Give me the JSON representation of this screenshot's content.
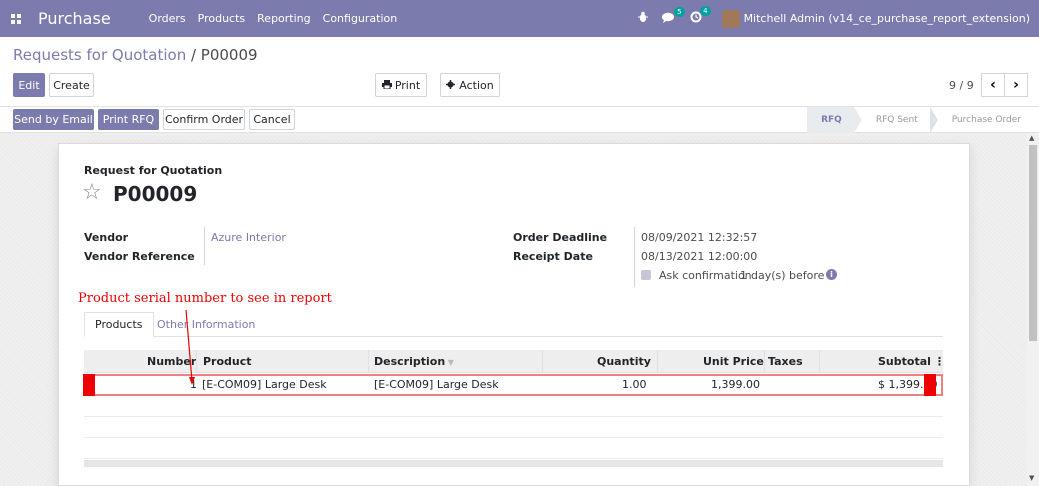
{
  "navbar": {
    "brand": "Purchase",
    "menu": [
      "Orders",
      "Products",
      "Reporting",
      "Configuration"
    ],
    "bug_icon": "bug-icon",
    "chat_badge": "5",
    "activity_badge": "4",
    "user": "Mitchell Admin (v14_ce_purchase_report_extension)"
  },
  "breadcrumb": {
    "parent": "Requests for Quotation",
    "separator": " / ",
    "current": "P00009"
  },
  "control": {
    "edit": "Edit",
    "create": "Create",
    "print": "Print",
    "action": "Action",
    "pager": "9 / 9",
    "prev": "‹",
    "next": "›"
  },
  "statusbar": {
    "buttons": [
      "Send by Email",
      "Print RFQ",
      "Confirm Order",
      "Cancel"
    ],
    "stages": [
      "RFQ",
      "RFQ Sent",
      "Purchase Order"
    ],
    "active_stage": "RFQ"
  },
  "form": {
    "doc_kind": "Request for Quotation",
    "name": "P00009",
    "vendor_label": "Vendor",
    "vendor": "Azure Interior",
    "vendor_ref_label": "Vendor Reference",
    "vendor_ref": "",
    "deadline_label": "Order Deadline",
    "deadline": "08/09/2021 12:32:57",
    "receipt_label": "Receipt Date",
    "receipt": "08/13/2021 12:00:00",
    "ask_confirmation_pre": "Ask confirmation",
    "ask_confirmation_days": "1",
    "ask_confirmation_post": "day(s) before",
    "ask_confirmation_checked": true
  },
  "annotation": "Product serial number to see in report",
  "tabs": [
    "Products",
    "Other Information"
  ],
  "table": {
    "headers": [
      "Number",
      "Product",
      "Description",
      "Quantity",
      "Unit Price",
      "Taxes",
      "Subtotal"
    ],
    "rows": [
      {
        "number": "1",
        "product": "[E-COM09] Large Desk",
        "description": "[E-COM09] Large Desk",
        "quantity": "1.00",
        "unit_price": "1,399.00",
        "taxes": "",
        "subtotal": "$ 1,399.00"
      }
    ]
  },
  "colors": {
    "brand": "#7c7bad",
    "annotation": "#ee0000",
    "badge": "#00a09d"
  }
}
